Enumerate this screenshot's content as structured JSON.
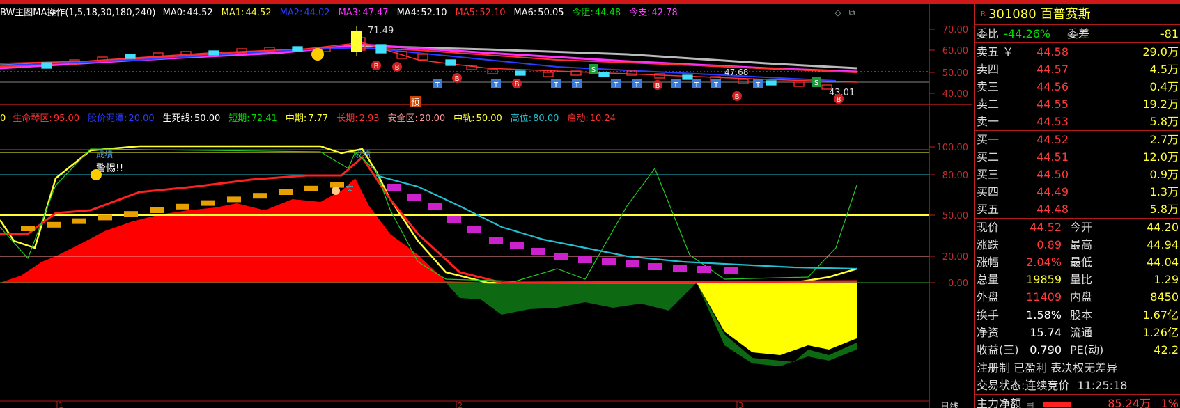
{
  "indicator_legend_main": {
    "title": "BW主图MA操作(1,5,18,30,180,240)",
    "items": [
      {
        "label": "MA0:",
        "value": "44.52",
        "color": "#ffffff"
      },
      {
        "label": "MA1:",
        "value": "44.52",
        "color": "#ffff33"
      },
      {
        "label": "MA2:",
        "value": "44.02",
        "color": "#2a3cff"
      },
      {
        "label": "MA3:",
        "value": "47.47",
        "color": "#ff33ff"
      },
      {
        "label": "MA4:",
        "value": "52.10",
        "color": "#ffffff"
      },
      {
        "label": "MA5:",
        "value": "52.10",
        "color": "#ff3030"
      },
      {
        "label": "MA6:",
        "value": "50.05",
        "color": "#ffffff"
      },
      {
        "label": "今阻:",
        "value": "44.48",
        "color": "#00e000"
      },
      {
        "label": "今支:",
        "value": "42.78",
        "color": "#ff44ff"
      }
    ]
  },
  "indicator_legend_sub": {
    "prefix": "0",
    "items": [
      {
        "label": "生命琴区:",
        "value": "95.00",
        "color": "#ff3030"
      },
      {
        "label": "股价泥潭:",
        "value": "20.00",
        "color": "#2a3cff"
      },
      {
        "label": "生死线:",
        "value": "50.00",
        "color": "#ffffff"
      },
      {
        "label": "短期:",
        "value": "72.41",
        "color": "#00e000"
      },
      {
        "label": "中期:",
        "value": "7.77",
        "color": "#ffff33"
      },
      {
        "label": "长期:",
        "value": "2.93",
        "color": "#ff3030"
      },
      {
        "label": "安全区:",
        "value": "20.00",
        "color": "#ff9999"
      },
      {
        "label": "中轨:",
        "value": "50.00",
        "color": "#ffff33"
      },
      {
        "label": "高位:",
        "value": "80.00",
        "color": "#22c0d0"
      },
      {
        "label": "启动:",
        "value": "10.24",
        "color": "#ff3030"
      }
    ]
  },
  "main_axis": [
    "70.00",
    "60.00",
    "50.00",
    "40.00"
  ],
  "sub_axis": [
    "100.00",
    "80.00",
    "50.00",
    "20.00",
    "0.00"
  ],
  "chart_annotations": {
    "peak_label": "71.49",
    "low_label": "43.01",
    "mid_label": "47.68",
    "predict_label": "预",
    "warn_text": "警惕!!",
    "buy_label": "成绩",
    "buy_label2": "成绩",
    "sell_label": "卖"
  },
  "bottom_axis": [
    "1",
    "2",
    "3"
  ],
  "bottom_axis_right": "日线",
  "quote": {
    "code": "301080",
    "name": "百普赛斯",
    "flag": "R",
    "weibi_label": "委比",
    "weibi_value": "-44.26%",
    "weicha_label": "委差",
    "weicha_value": "-81",
    "sell": [
      {
        "label": "卖五",
        "mark": "￥",
        "price": "44.58",
        "vol": "29.0万"
      },
      {
        "label": "卖四",
        "mark": "",
        "price": "44.57",
        "vol": "4.5万"
      },
      {
        "label": "卖三",
        "mark": "",
        "price": "44.56",
        "vol": "0.4万"
      },
      {
        "label": "卖二",
        "mark": "",
        "price": "44.55",
        "vol": "19.2万"
      },
      {
        "label": "卖一",
        "mark": "",
        "price": "44.53",
        "vol": "5.8万"
      }
    ],
    "buy": [
      {
        "label": "买一",
        "price": "44.52",
        "vol": "2.7万"
      },
      {
        "label": "买二",
        "price": "44.51",
        "vol": "12.0万"
      },
      {
        "label": "买三",
        "price": "44.50",
        "vol": "0.9万"
      },
      {
        "label": "买四",
        "price": "44.49",
        "vol": "1.3万"
      },
      {
        "label": "买五",
        "price": "44.48",
        "vol": "5.8万"
      }
    ],
    "stats1": [
      {
        "l1": "现价",
        "v1": "44.52",
        "c1": "red",
        "l2": "今开",
        "v2": "44.20",
        "c2": "red"
      },
      {
        "l1": "涨跌",
        "v1": "0.89",
        "c1": "red",
        "l2": "最高",
        "v2": "44.94",
        "c2": "red"
      },
      {
        "l1": "涨幅",
        "v1": "2.04%",
        "c1": "red",
        "l2": "最低",
        "v2": "44.04",
        "c2": "red"
      },
      {
        "l1": "总量",
        "v1": "19859",
        "c1": "yellow",
        "l2": "量比",
        "v2": "1.29",
        "c2": "red"
      },
      {
        "l1": "外盘",
        "v1": "11409",
        "c1": "red",
        "l2": "内盘",
        "v2": "8450",
        "c2": "green"
      }
    ],
    "stats2": [
      {
        "l1": "换手",
        "v1": "1.58%",
        "c1": "white",
        "l2": "股本",
        "v2": "1.67亿",
        "c2": "white"
      },
      {
        "l1": "净资",
        "v1": "15.74",
        "c1": "white",
        "l2": "流通",
        "v2": "1.26亿",
        "c2": "white"
      },
      {
        "l1": "收益(三)",
        "v1": "0.790",
        "c1": "white",
        "l2": "PE(动)",
        "v2": "42.2",
        "c2": "white"
      }
    ],
    "reg_line": "注册制 已盈利 表决权无差异",
    "trade_status_label": "交易状态:",
    "trade_status_value": "连续竞价",
    "trade_time": "11:25:18",
    "main_net_label": "主力净额",
    "main_net_value": "85.24万",
    "main_net_pct": "1%"
  }
}
